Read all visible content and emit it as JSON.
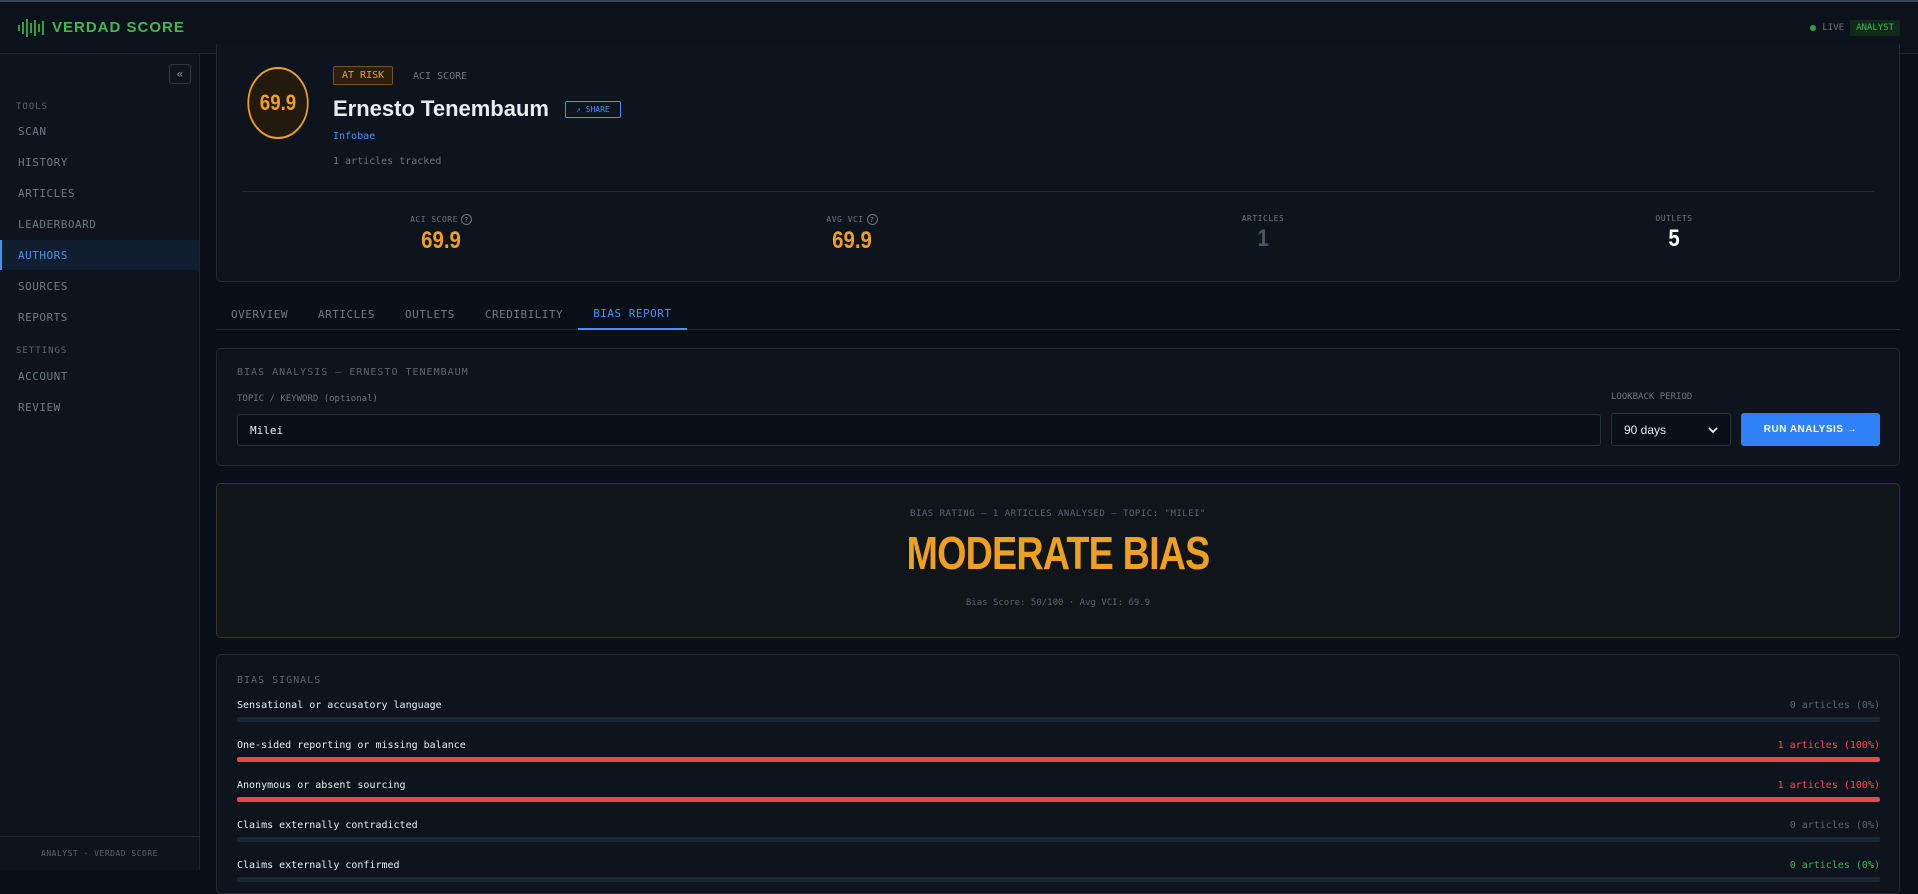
{
  "app": {
    "name": "VERDAD SCORE",
    "status_live": "LIVE",
    "role": "ANALYST",
    "accent": "#2ea043"
  },
  "sidebar": {
    "collapse_icon": "«",
    "groups": [
      {
        "label": "TOOLS",
        "items": [
          "SCAN",
          "HISTORY",
          "ARTICLES",
          "LEADERBOARD",
          "AUTHORS",
          "SOURCES",
          "REPORTS"
        ]
      },
      {
        "label": "SETTINGS",
        "items": [
          "ACCOUNT",
          "REVIEW"
        ]
      }
    ],
    "active_item": "AUTHORS",
    "footer": "ANALYST · VERDAD SCORE"
  },
  "profile": {
    "score": "69.9",
    "risk_badge": "AT RISK",
    "score_label": "ACI SCORE",
    "name": "Ernesto Tenembaum",
    "share_label": "↗ SHARE",
    "outlet": "Infobae",
    "tracked": "1 articles tracked",
    "stats": [
      {
        "label": "ACI SCORE",
        "value": "69.9",
        "help": true,
        "color": "#f0a020"
      },
      {
        "label": "AVG VCI",
        "value": "69.9",
        "help": true,
        "color": "#f0a020"
      },
      {
        "label": "ARTICLES",
        "value": "1",
        "help": false,
        "color": "#4a5663"
      },
      {
        "label": "OUTLETS",
        "value": "5",
        "help": false,
        "color": "#ffffff"
      }
    ]
  },
  "tabs": [
    {
      "label": "OVERVIEW",
      "active": false
    },
    {
      "label": "ARTICLES",
      "active": false
    },
    {
      "label": "OUTLETS",
      "active": false
    },
    {
      "label": "CREDIBILITY",
      "active": false
    },
    {
      "label": "BIAS REPORT",
      "active": true
    }
  ],
  "analysis": {
    "title": "BIAS ANALYSIS — ERNESTO TENEMBAUM",
    "topic_label": "TOPIC / KEYWORD (optional)",
    "topic_value": "Milei",
    "period_label": "LOOKBACK PERIOD",
    "period_value": "90 days",
    "run_label": "RUN ANALYSIS →"
  },
  "rating": {
    "subtitle": "BIAS RATING — 1 ARTICLES ANALYSED — TOPIC: \"MILEI\"",
    "headline": "MODERATE BIAS",
    "footer": "Bias Score: 50/100 · Avg VCI: 69.9"
  },
  "signals": {
    "title": "BIAS SIGNALS",
    "items": [
      {
        "name": "Sensational or accusatory language",
        "count": "0 articles (0%)",
        "percent": 0,
        "tone": "neutral"
      },
      {
        "name": "One-sided reporting or missing balance",
        "count": "1 articles (100%)",
        "percent": 100,
        "tone": "hot"
      },
      {
        "name": "Anonymous or absent sourcing",
        "count": "1 articles (100%)",
        "percent": 100,
        "tone": "hot"
      },
      {
        "name": "Claims externally contradicted",
        "count": "0 articles (0%)",
        "percent": 0,
        "tone": "neutral"
      },
      {
        "name": "Claims externally confirmed",
        "count": "0 articles (0%)",
        "percent": 0,
        "tone": "good"
      }
    ]
  }
}
